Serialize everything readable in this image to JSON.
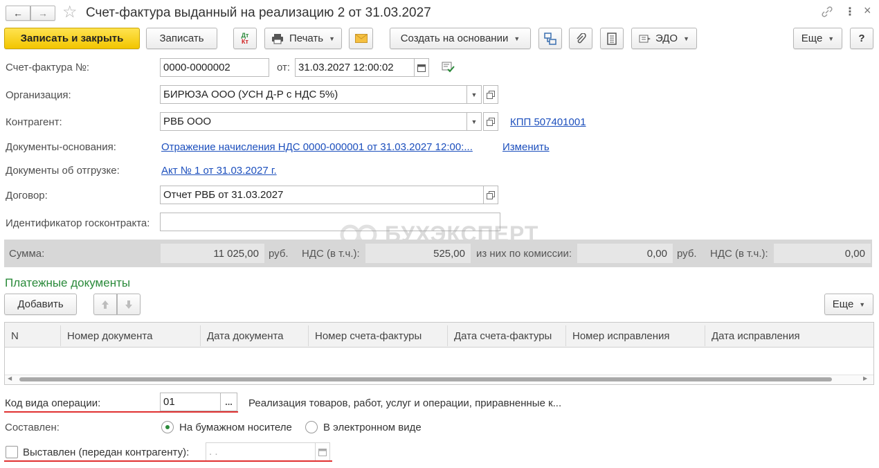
{
  "window": {
    "title": "Счет-фактура выданный на реализацию 2 от 31.03.2027",
    "back_icon": "←",
    "forward_icon": "→",
    "star_icon": "☆",
    "link_icon": "🔗",
    "more_icon": "⋮",
    "close_icon": "×"
  },
  "toolbar": {
    "save_close": "Записать и закрыть",
    "save": "Записать",
    "dtkt_top": "Дт",
    "dtkt_bottom": "Кт",
    "print": "Печать",
    "create_based": "Создать на основании",
    "edo": "ЭДО",
    "more": "Еще",
    "help": "?"
  },
  "form": {
    "invoice_label": "Счет-фактура №:",
    "invoice_number": "0000-0000002",
    "date_label": "от:",
    "date_value": "31.03.2027 12:00:02",
    "org_label": "Организация:",
    "org_value": "БИРЮЗА ООО (УСН Д-Р с НДС 5%)",
    "counterparty_label": "Контрагент:",
    "counterparty_value": "РВБ ООО",
    "kpp_link": "КПП 507401001",
    "base_docs_label": "Документы-основания:",
    "base_docs_link": "Отражение начисления НДС 0000-000001 от 31.03.2027 12:00:...",
    "change_link": "Изменить",
    "shipment_label": "Документы об отгрузке:",
    "shipment_link": "Акт № 1 от 31.03.2027 г.",
    "contract_label": "Договор:",
    "contract_value": "Отчет РВБ от 31.03.2027",
    "gov_id_label": "Идентификатор госконтракта:",
    "gov_id_value": ""
  },
  "watermark": "БУХЭКСПЕРТ",
  "summary": {
    "sum_label": "Сумма:",
    "sum_value": "11 025,00",
    "currency": "руб.",
    "vat_label": "НДС (в т.ч.):",
    "vat_value": "525,00",
    "commission_label": "из них по комиссии:",
    "commission_value": "0,00",
    "currency2": "руб.",
    "vat2_label": "НДС (в т.ч.):",
    "vat2_value": "0,00"
  },
  "payments": {
    "title": "Платежные документы",
    "add": "Добавить",
    "more": "Еще",
    "columns": [
      "N",
      "Номер документа",
      "Дата документа",
      "Номер счета-фактуры",
      "Дата счета-фактуры",
      "Номер исправления",
      "Дата исправления"
    ]
  },
  "bottom": {
    "op_code_label": "Код вида операции:",
    "op_code_value": "01",
    "op_code_btn": "...",
    "op_code_desc": "Реализация товаров, работ, услуг и операции, приравненные к...",
    "composed_label": "Составлен:",
    "paper": "На бумажном носителе",
    "electronic": "В электронном виде",
    "issued_label": "Выставлен (передан контрагенту):",
    "issued_date": " .  ."
  },
  "colors": {
    "accent_green": "#2a8a3a",
    "link_blue": "#1c4fbd",
    "primary_yellow": "#f2c500",
    "underline_red": "#e03030"
  }
}
